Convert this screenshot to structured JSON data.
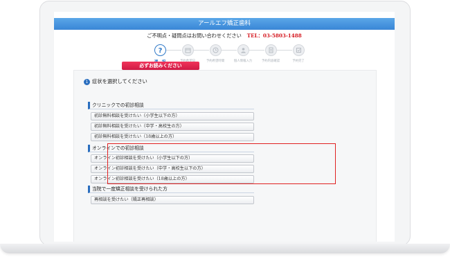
{
  "window": {
    "title": "アールエフ矯正歯科"
  },
  "contact": {
    "text": "ご不明点・疑問点はお問い合わせください",
    "tel": "TEL：03-5803-1488"
  },
  "steps": [
    {
      "label": "選　択",
      "icon": "question-icon",
      "active": true
    },
    {
      "label": "予約希望日",
      "icon": "calendar-icon"
    },
    {
      "label": "予約希望時間",
      "icon": "clock-icon"
    },
    {
      "label": "個人情報入力",
      "icon": "person-icon"
    },
    {
      "label": "予約内容確認",
      "icon": "document-icon"
    },
    {
      "label": "予約完了",
      "icon": "check-icon"
    }
  ],
  "notice_button": "必ずお読みください",
  "question": {
    "number": "1",
    "title": "症状を選択してください"
  },
  "groups": [
    {
      "heading": "クリニックでの初診相談",
      "options": [
        "初診無料相談を受けたい（小学生以下の方）",
        "初診無料相談を受けたい（中学・高校生の方）",
        "初診無料相談を受けたい（18歳以上の方）"
      ]
    },
    {
      "heading": "オンラインでの初診相談",
      "options": [
        "オンライン初診相談を受けたい（小学生以下の方）",
        "オンライン初診相談を受けたい（中学・高校生以下の方）",
        "オンライン初診相談を受けたい（18歳以上の方）"
      ]
    },
    {
      "heading": "当院で一度矯正相談を受けられた方",
      "options": [
        "再相談を受けたい（矯正再相談）"
      ]
    }
  ],
  "colors": {
    "accent": "#2a6ebf",
    "highlight": "#e02020",
    "notice": "#d01a45",
    "tel": "#d4161e"
  }
}
